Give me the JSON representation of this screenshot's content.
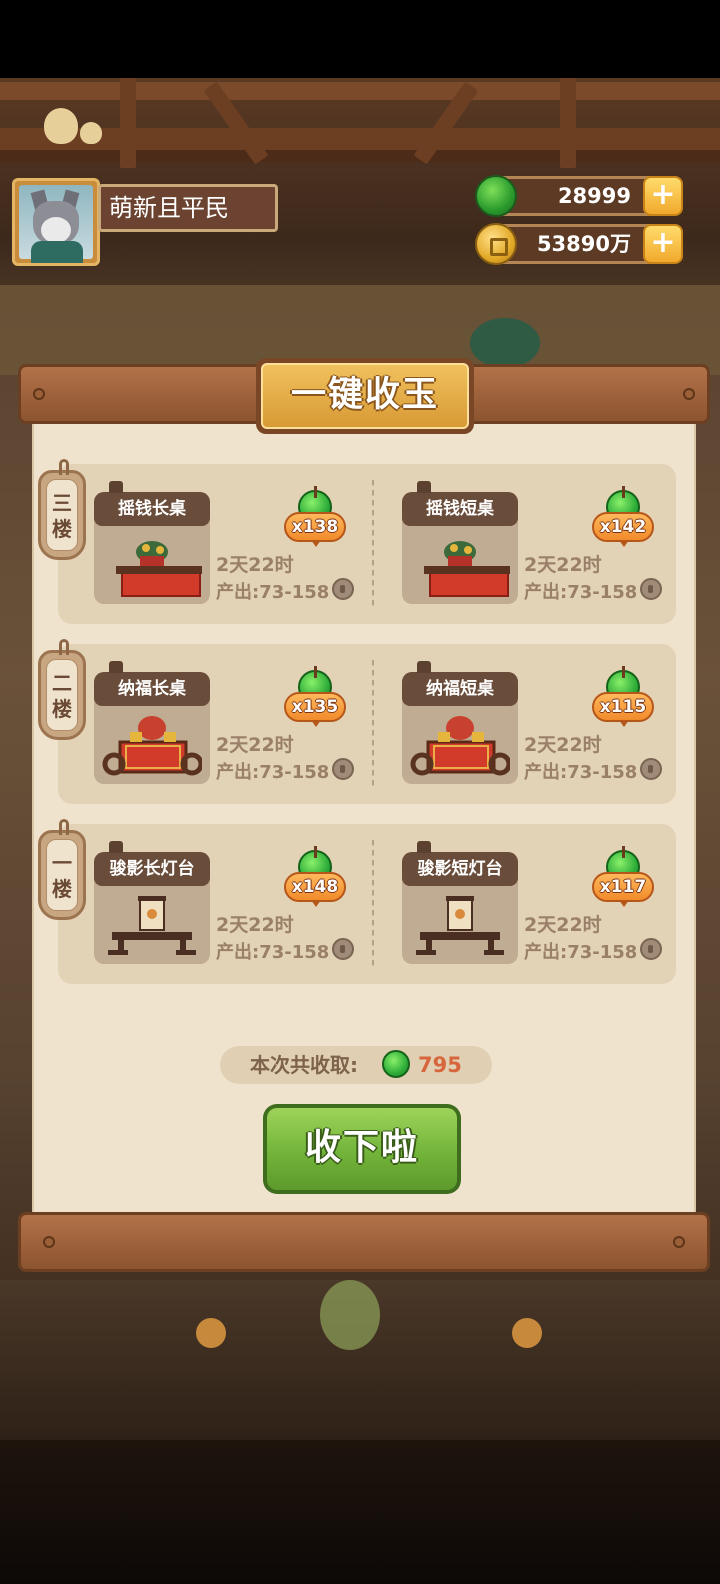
{
  "header": {
    "player_name": "萌新且平民",
    "jade_amount": "28999",
    "coin_amount": "53890万",
    "plus_symbol": "+"
  },
  "panel": {
    "title": "一键收玉",
    "floors": [
      {
        "tag": "三楼",
        "items": [
          {
            "name": "摇钱长桌",
            "jade": "x138",
            "time": "2天22时",
            "output": "产出:73-158"
          },
          {
            "name": "摇钱短桌",
            "jade": "x142",
            "time": "2天22时",
            "output": "产出:73-158"
          }
        ]
      },
      {
        "tag": "二楼",
        "items": [
          {
            "name": "纳福长桌",
            "jade": "x135",
            "time": "2天22时",
            "output": "产出:73-158"
          },
          {
            "name": "纳福短桌",
            "jade": "x115",
            "time": "2天22时",
            "output": "产出:73-158"
          }
        ]
      },
      {
        "tag": "一楼",
        "items": [
          {
            "name": "骏影长灯台",
            "jade": "x148",
            "time": "2天22时",
            "output": "产出:73-158"
          },
          {
            "name": "骏影短灯台",
            "jade": "x117",
            "time": "2天22时",
            "output": "产出:73-158"
          }
        ]
      }
    ],
    "total_label": "本次共收取:",
    "total_value": "795",
    "collect_button": "收下啦"
  },
  "icons": {
    "jade": "jade-icon",
    "coin": "coin-icon",
    "plus": "plus-icon",
    "output_coin": "coin-icon"
  },
  "colors": {
    "collect_green": "#72b43a",
    "title_gold": "#e8ad45",
    "jade_badge_orange": "#f18b2b",
    "total_value_red": "#d8663c"
  }
}
